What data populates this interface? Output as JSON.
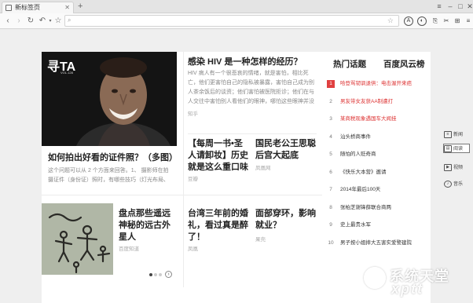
{
  "browser": {
    "tab_title": "新标签页",
    "address_value": "",
    "new_tab_symbol": "+"
  },
  "feed": {
    "hero": {
      "cover_logo": "寻TA",
      "cover_vol": "VOL.128",
      "title": "如何拍出好看的证件照？（多图）",
      "summary": "这个问题可以从 2 个方面来回答。1、 摄影师在拍摄证件（身份证）照时，有哪些技巧（灯光布局、器材、构图…"
    },
    "hiv": {
      "title": "感染 HIV 是一种怎样的经历？",
      "summary": "HIV 病人有一个很悲哀的情绪，就是害怕，相比死亡，他们更害怕自己的隐私被暴露，害怕自己成为别人茶余饭后的谈资；他们害怕被医院拒诊；他们在与人交往中害怕别人看他们的眼神，哪怕这些眼神并没有什么特殊；他们害怕…",
      "source": "知乎"
    },
    "card_a": {
      "title": "【每周一书•圣人请卸妆】历史就是这么重口味",
      "source": "豆瓣"
    },
    "card_b": {
      "title": "国民老公王思聪后宫大起底",
      "source": "凤凰网"
    },
    "aliens": {
      "title": "盘点那些遥远神秘的远古外星人",
      "source": "百度知道"
    },
    "card_c": {
      "title": "台湾三年前的婚礼，看过真是醉了！",
      "source": "凤凰"
    },
    "card_d": {
      "title": "面部穿环，影响就业？",
      "source": "果壳"
    },
    "pager_next": "›"
  },
  "sidebar": {
    "tab_hot": "热门话题",
    "tab_baidu": "百度风云榜",
    "items": [
      {
        "rank": "1",
        "text": "哈登骂韧讽退供：电击渥开来疤",
        "hot": true
      },
      {
        "rank": "2",
        "text": "男友带女友获AA制遭打",
        "hot": true
      },
      {
        "rank": "3",
        "text": "某商税现象遇国车大闻挂",
        "hot": true
      },
      {
        "rank": "4",
        "text": "汕头桥商事件",
        "hot": false
      },
      {
        "rank": "5",
        "text": "随怕的人贬奇商",
        "hot": false
      },
      {
        "rank": "6",
        "text": "《快乐大本营》邀请",
        "hot": false
      },
      {
        "rank": "7",
        "text": "2014年最后100天",
        "hot": false
      },
      {
        "rank": "8",
        "text": "张柏芝谢锋薛联合商两",
        "hot": false
      },
      {
        "rank": "9",
        "text": "史上最贵水军",
        "hot": false
      },
      {
        "rank": "10",
        "text": "男子按小姐摔大五害实爱警建院",
        "hot": false
      }
    ]
  },
  "tools": {
    "news": "新闻",
    "read": "阅读",
    "video": "视频",
    "music": "音乐"
  },
  "watermark": {
    "line1": "系统天堂",
    "line2": "xptt"
  }
}
